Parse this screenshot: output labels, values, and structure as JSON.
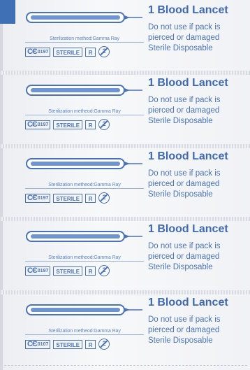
{
  "packs": [
    {
      "title": "1 Blood Lancet",
      "sterilization": "Sterilization method:Gamma Ray",
      "ce": "0197",
      "sterile": "STERILE",
      "r": "R",
      "warning1": "Do not use if pack is",
      "warning2": "pierced or damaged",
      "disposable": "Sterile Disposable"
    },
    {
      "title": "1 Blood Lancet",
      "sterilization": "Sterilization metheod:Gamma Ray",
      "ce": "0197",
      "sterile": "STERILE",
      "r": "R",
      "warning1": "Do not use if pack is",
      "warning2": "pierced or damaged",
      "disposable": "Sterile Disposable"
    },
    {
      "title": "1 Blood Lancet",
      "sterilization": "Sterilization metheod:Gamma Ray",
      "ce": "0197",
      "sterile": "STERILE",
      "r": "R",
      "warning1": "Do not use if pack is",
      "warning2": "pierced or damaged",
      "disposable": "Sterile Disposable"
    },
    {
      "title": "1 Blood Lancet",
      "sterilization": "Sterilization metheod:Gamma Ray",
      "ce": "0197",
      "sterile": "STERILE",
      "r": "R",
      "warning1": "Do not use if pack is",
      "warning2": "pierced or damaged",
      "disposable": "Sterile Disposable"
    },
    {
      "title": "1 Blood Lancet",
      "sterilization": "Sterilization metheod:Gamma Ray",
      "ce": "0107",
      "sterile": "STERILE",
      "r": "R",
      "warning1": "Do not use if pack is",
      "warning2": "pierced or damaged",
      "disposable": "Sterile Disposable"
    }
  ],
  "colors": {
    "print_blue": "#3f69b3",
    "packaging": "#f1f2f5",
    "corner_tab": "#3f6fb4"
  },
  "icons": {
    "lancet": "lancet-illustration",
    "single_use": "do-not-reuse-icon"
  }
}
